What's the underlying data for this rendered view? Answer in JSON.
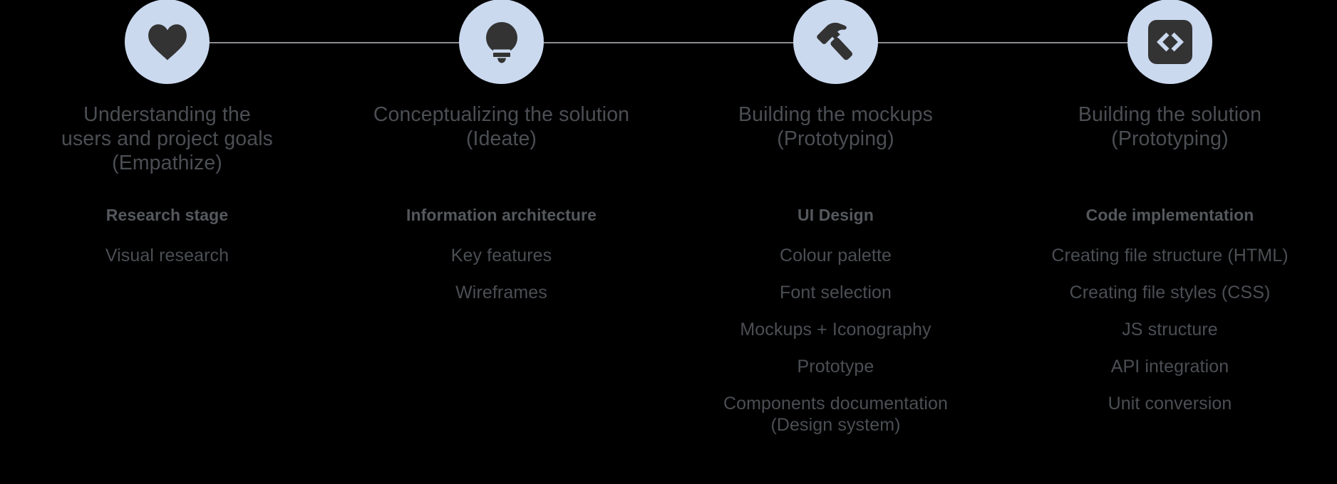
{
  "theme": {
    "background": "#000000",
    "node_circle_fill": "#cbd9ef",
    "node_icon_fill": "#333333",
    "connector_line": "#8b8d93",
    "title_text": "#4b4e53",
    "subtitle_text": "#55585d",
    "item_text": "#4b4e53"
  },
  "process": {
    "steps": [
      {
        "icon": "heart-icon",
        "title": "Understanding the\nusers and project goals\n(Empathize)",
        "subtitle": "Research stage",
        "items": [
          "Visual research"
        ]
      },
      {
        "icon": "lightbulb-icon",
        "title": "Conceptualizing the solution\n(Ideate)",
        "subtitle": "Information architecture",
        "items": [
          "Key features",
          "Wireframes"
        ]
      },
      {
        "icon": "hammer-icon",
        "title": "Building the mockups\n(Prototyping)",
        "subtitle": "UI Design",
        "items": [
          "Colour palette",
          "Font selection",
          "Mockups + Iconography",
          "Prototype",
          "Components documentation\n(Design system)"
        ]
      },
      {
        "icon": "code-icon",
        "title": "Building the solution\n(Prototyping)",
        "subtitle": "Code implementation",
        "items": [
          "Creating file structure (HTML)",
          "Creating file styles (CSS)",
          "JS structure",
          "API integration",
          "Unit conversion"
        ]
      }
    ]
  }
}
